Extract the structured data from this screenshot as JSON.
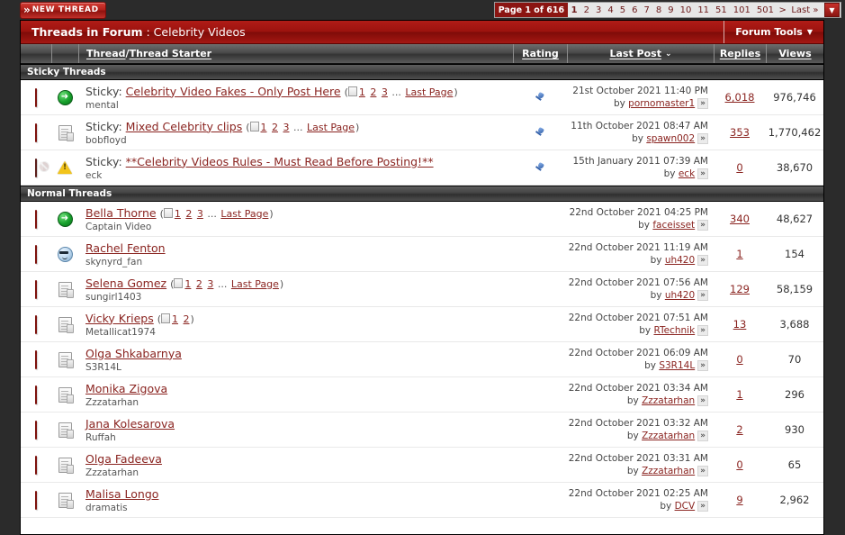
{
  "topbar": {
    "new_thread_label": "New Thread",
    "new_thread_chevrons": "»",
    "pagination": {
      "current_label": "Page 1 of 616",
      "pages": [
        "1",
        "2",
        "3",
        "4",
        "5",
        "6",
        "7",
        "8",
        "9",
        "10",
        "11",
        "51",
        "101",
        "501"
      ],
      "next_symbol": ">",
      "last_label": "Last »",
      "dropdown_icon": "▼"
    }
  },
  "panel": {
    "header_title_bold": "Threads in Forum",
    "header_title_sep": " : ",
    "header_title_forum": "Celebrity Videos",
    "forum_tools_label": "Forum Tools",
    "forum_tools_caret": "▼"
  },
  "columns": {
    "thread": "Thread",
    "thread_sep": " / ",
    "thread_starter": "Thread Starter",
    "rating": "Rating",
    "last_post": "Last Post",
    "last_post_sort": "⌄",
    "replies": "Replies",
    "views": "Views"
  },
  "sections": [
    {
      "name": "Sticky Threads",
      "rows": [
        {
          "folder_icon": "red-folder-icon",
          "status_icon": "green-arrow-icon",
          "prefix": "Sticky:",
          "title": "Celebrity Video Fakes - Only Post Here",
          "has_pages": true,
          "pages": [
            "1",
            "2",
            "3"
          ],
          "pages_ellipsis": "...",
          "last_page": "Last Page",
          "starter": "mental",
          "rating_icon": "pin-icon",
          "last_post_date": "21st October 2021 11:40 PM",
          "last_post_by_prefix": "by",
          "last_post_by": "pornomaster1",
          "goto_last": "»",
          "replies": "6,018",
          "views": "976,746"
        },
        {
          "folder_icon": "red-folder-icon",
          "status_icon": "document-icon",
          "prefix": "Sticky:",
          "title": "Mixed Celebrity clips",
          "has_pages": true,
          "pages": [
            "1",
            "2",
            "3"
          ],
          "pages_ellipsis": "...",
          "last_page": "Last Page",
          "starter": "bobfloyd",
          "rating_icon": "pin-icon",
          "last_post_date": "11th October 2021 08:47 AM",
          "last_post_by_prefix": "by",
          "last_post_by": "spawn002",
          "goto_last": "»",
          "replies": "353",
          "views": "1,770,462"
        },
        {
          "folder_icon": "locked-folder-icon",
          "status_icon": "warning-icon",
          "prefix": "Sticky:",
          "title": "**Celebrity Videos Rules - Must Read Before Posting!**",
          "has_pages": false,
          "pages": [],
          "pages_ellipsis": "",
          "last_page": "",
          "starter": "eck",
          "rating_icon": "pin-icon",
          "last_post_date": "15th January 2011 07:39 AM",
          "last_post_by_prefix": "by",
          "last_post_by": "eck",
          "goto_last": "»",
          "replies": "0",
          "views": "38,670"
        }
      ]
    },
    {
      "name": "Normal Threads",
      "rows": [
        {
          "folder_icon": "red-folder-icon",
          "status_icon": "green-arrow-icon",
          "prefix": "",
          "title": "Bella Thorne",
          "has_pages": true,
          "pages": [
            "1",
            "2",
            "3"
          ],
          "pages_ellipsis": "...",
          "last_page": "Last Page",
          "starter": "Captain Video",
          "rating_icon": "",
          "last_post_date": "22nd October 2021 04:25 PM",
          "last_post_by_prefix": "by",
          "last_post_by": "faceisset",
          "goto_last": "»",
          "replies": "340",
          "views": "48,627"
        },
        {
          "folder_icon": "red-folder-icon",
          "status_icon": "smiley-icon",
          "prefix": "",
          "title": "Rachel Fenton",
          "has_pages": false,
          "pages": [],
          "pages_ellipsis": "",
          "last_page": "",
          "starter": "skynyrd_fan",
          "rating_icon": "",
          "last_post_date": "22nd October 2021 11:19 AM",
          "last_post_by_prefix": "by",
          "last_post_by": "uh420",
          "goto_last": "»",
          "replies": "1",
          "views": "154"
        },
        {
          "folder_icon": "red-folder-icon",
          "status_icon": "document-icon",
          "prefix": "",
          "title": "Selena Gomez",
          "has_pages": true,
          "pages": [
            "1",
            "2",
            "3"
          ],
          "pages_ellipsis": "...",
          "last_page": "Last Page",
          "starter": "sungirl1403",
          "rating_icon": "",
          "last_post_date": "22nd October 2021 07:56 AM",
          "last_post_by_prefix": "by",
          "last_post_by": "uh420",
          "goto_last": "»",
          "replies": "129",
          "views": "58,159"
        },
        {
          "folder_icon": "red-folder-icon",
          "status_icon": "document-icon",
          "prefix": "",
          "title": "Vicky Krieps",
          "has_pages": true,
          "pages": [
            "1",
            "2"
          ],
          "pages_ellipsis": "",
          "last_page": "",
          "starter": "Metallicat1974",
          "rating_icon": "",
          "last_post_date": "22nd October 2021 07:51 AM",
          "last_post_by_prefix": "by",
          "last_post_by": "RTechnik",
          "goto_last": "»",
          "replies": "13",
          "views": "3,688"
        },
        {
          "folder_icon": "red-folder-icon",
          "status_icon": "document-icon",
          "prefix": "",
          "title": "Olga Shkabarnya",
          "has_pages": false,
          "pages": [],
          "pages_ellipsis": "",
          "last_page": "",
          "starter": "S3R14L",
          "rating_icon": "",
          "last_post_date": "22nd October 2021 06:09 AM",
          "last_post_by_prefix": "by",
          "last_post_by": "S3R14L",
          "goto_last": "»",
          "replies": "0",
          "views": "70"
        },
        {
          "folder_icon": "red-folder-icon",
          "status_icon": "document-icon",
          "prefix": "",
          "title": "Monika Zigova",
          "has_pages": false,
          "pages": [],
          "pages_ellipsis": "",
          "last_page": "",
          "starter": "Zzzatarhan",
          "rating_icon": "",
          "last_post_date": "22nd October 2021 03:34 AM",
          "last_post_by_prefix": "by",
          "last_post_by": "Zzzatarhan",
          "goto_last": "»",
          "replies": "1",
          "views": "296"
        },
        {
          "folder_icon": "red-folder-icon",
          "status_icon": "document-icon",
          "prefix": "",
          "title": "Jana Kolesarova",
          "has_pages": false,
          "pages": [],
          "pages_ellipsis": "",
          "last_page": "",
          "starter": "Ruffah",
          "rating_icon": "",
          "last_post_date": "22nd October 2021 03:32 AM",
          "last_post_by_prefix": "by",
          "last_post_by": "Zzzatarhan",
          "goto_last": "»",
          "replies": "2",
          "views": "930"
        },
        {
          "folder_icon": "red-folder-icon",
          "status_icon": "document-icon",
          "prefix": "",
          "title": "Olga Fadeeva",
          "has_pages": false,
          "pages": [],
          "pages_ellipsis": "",
          "last_page": "",
          "starter": "Zzzatarhan",
          "rating_icon": "",
          "last_post_date": "22nd October 2021 03:31 AM",
          "last_post_by_prefix": "by",
          "last_post_by": "Zzzatarhan",
          "goto_last": "»",
          "replies": "0",
          "views": "65"
        },
        {
          "folder_icon": "red-folder-icon",
          "status_icon": "document-icon",
          "prefix": "",
          "title": "Malisa Longo",
          "has_pages": false,
          "pages": [],
          "pages_ellipsis": "",
          "last_page": "",
          "starter": "dramatis",
          "rating_icon": "",
          "last_post_date": "22nd October 2021 02:25 AM",
          "last_post_by_prefix": "by",
          "last_post_by": "DCV",
          "goto_last": "»",
          "replies": "9",
          "views": "2,962"
        }
      ]
    }
  ],
  "colors": {
    "brand_red": "#9b120e",
    "link_red": "#8a2420",
    "page_bg": "#2b2b2b"
  }
}
